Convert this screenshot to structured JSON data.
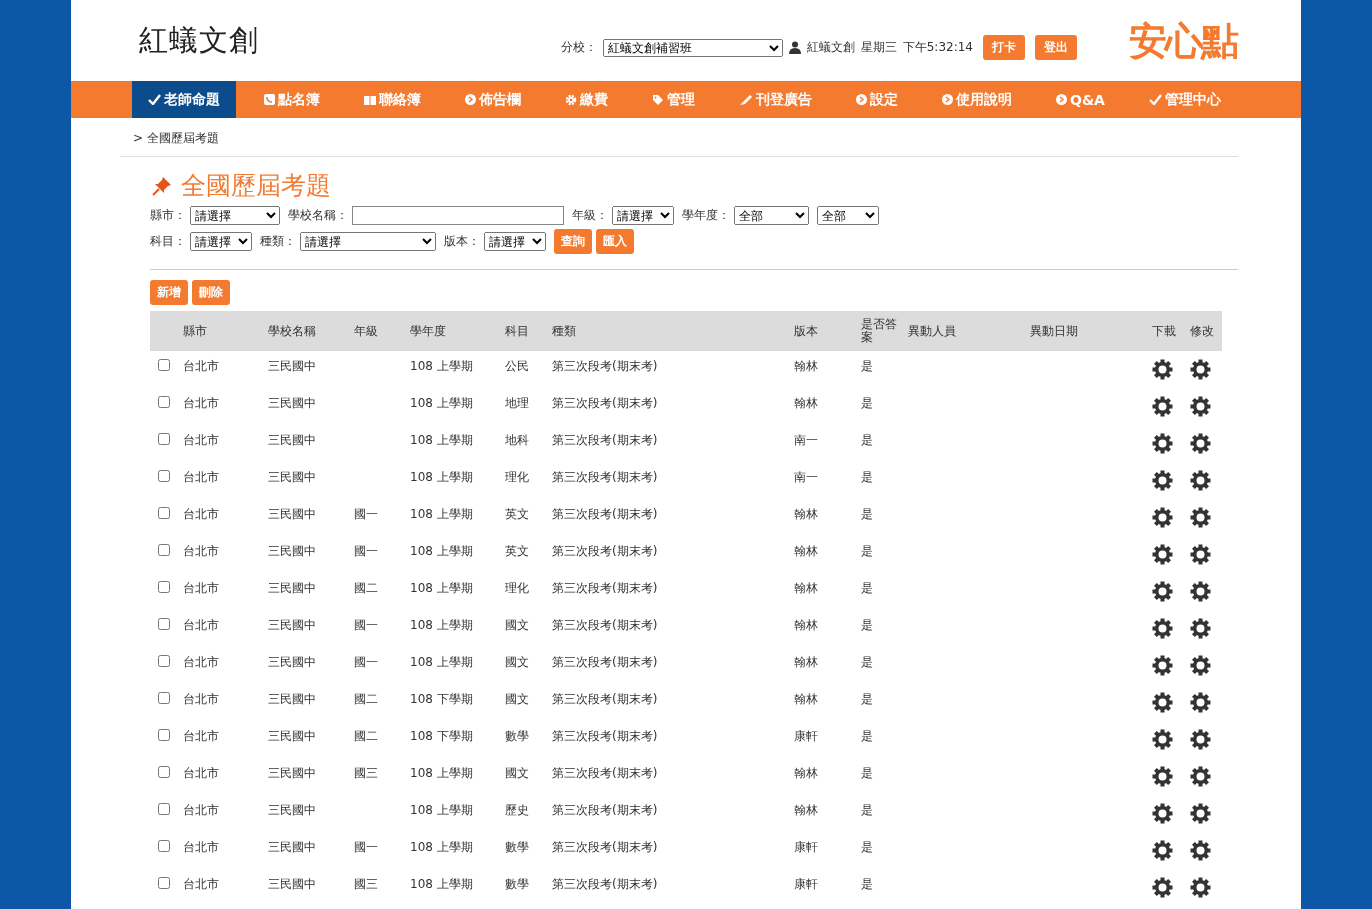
{
  "header": {
    "site_title": "紅蟻文創",
    "branch_label": "分校：",
    "branch_value": "紅蟻文創補習班",
    "user_name": "紅蟻文創",
    "weekday": "星期三",
    "time": "下午5:32:14",
    "buttons": [
      "打卡",
      "登出"
    ],
    "logo_text": "安心點"
  },
  "nav": [
    {
      "label": "老師命題",
      "selected": true
    },
    {
      "label": "點名簿",
      "selected": false
    },
    {
      "label": "聯絡簿",
      "selected": false
    },
    {
      "label": "佈告欄",
      "selected": false
    },
    {
      "label": "繳費",
      "selected": false
    },
    {
      "label": "管理",
      "selected": false
    },
    {
      "label": "刊登廣告",
      "selected": false
    },
    {
      "label": "設定",
      "selected": false
    },
    {
      "label": "使用說明",
      "selected": false
    },
    {
      "label": "Q&A",
      "selected": false
    },
    {
      "label": "管理中心",
      "selected": false
    }
  ],
  "breadcrumb": "> 全國歷屆考題",
  "page_title": "全國歷屆考題",
  "filters": {
    "row1": [
      {
        "label": "縣市：",
        "kind": "select",
        "value": "請選擇"
      },
      {
        "label": "學校名稱：",
        "kind": "input"
      },
      {
        "label": "年級：",
        "kind": "select",
        "value": "請選擇"
      },
      {
        "label": "學年度：",
        "kind": "select",
        "value": "全部"
      },
      {
        "kind": "select",
        "value": "全部"
      }
    ],
    "row2": [
      {
        "label": "科目：",
        "kind": "select",
        "value": "請選擇"
      },
      {
        "label": "種類：",
        "kind": "select",
        "value": "請選擇"
      },
      {
        "label": "版本：",
        "kind": "select",
        "value": "請選擇"
      }
    ],
    "buttons": [
      "查詢",
      "匯入"
    ]
  },
  "actions": [
    "新增",
    "刪除"
  ],
  "table": {
    "columns": [
      "縣市",
      "學校名稱",
      "年級",
      "學年度",
      "科目",
      "種類",
      "版本",
      "是否答案",
      "異動人員",
      "異動日期",
      "下載",
      "修改"
    ],
    "rows": [
      {
        "checked": false,
        "cells": [
          "台北市",
          "三民國中",
          "",
          "108 上學期",
          "公民",
          "第三次段考(期末考)",
          "翰林",
          "是",
          "",
          ""
        ]
      },
      {
        "checked": false,
        "cells": [
          "台北市",
          "三民國中",
          "",
          "108 上學期",
          "地理",
          "第三次段考(期末考)",
          "翰林",
          "是",
          "",
          ""
        ]
      },
      {
        "checked": false,
        "cells": [
          "台北市",
          "三民國中",
          "",
          "108 上學期",
          "地科",
          "第三次段考(期末考)",
          "南一",
          "是",
          "",
          ""
        ]
      },
      {
        "checked": false,
        "cells": [
          "台北市",
          "三民國中",
          "",
          "108 上學期",
          "理化",
          "第三次段考(期末考)",
          "南一",
          "是",
          "",
          ""
        ]
      },
      {
        "checked": false,
        "cells": [
          "台北市",
          "三民國中",
          "國一",
          "108 上學期",
          "英文",
          "第三次段考(期末考)",
          "翰林",
          "是",
          "",
          ""
        ]
      },
      {
        "checked": false,
        "cells": [
          "台北市",
          "三民國中",
          "國一",
          "108 上學期",
          "英文",
          "第三次段考(期末考)",
          "翰林",
          "是",
          "",
          ""
        ]
      },
      {
        "checked": false,
        "cells": [
          "台北市",
          "三民國中",
          "國二",
          "108 上學期",
          "理化",
          "第三次段考(期末考)",
          "翰林",
          "是",
          "",
          ""
        ]
      },
      {
        "checked": false,
        "cells": [
          "台北市",
          "三民國中",
          "國一",
          "108 上學期",
          "國文",
          "第三次段考(期末考)",
          "翰林",
          "是",
          "",
          ""
        ]
      },
      {
        "checked": false,
        "cells": [
          "台北市",
          "三民國中",
          "國一",
          "108 上學期",
          "國文",
          "第三次段考(期末考)",
          "翰林",
          "是",
          "",
          ""
        ]
      },
      {
        "checked": false,
        "cells": [
          "台北市",
          "三民國中",
          "國二",
          "108 下學期",
          "國文",
          "第三次段考(期末考)",
          "翰林",
          "是",
          "",
          ""
        ]
      },
      {
        "checked": false,
        "cells": [
          "台北市",
          "三民國中",
          "國二",
          "108 下學期",
          "數學",
          "第三次段考(期末考)",
          "康軒",
          "是",
          "",
          ""
        ]
      },
      {
        "checked": false,
        "cells": [
          "台北市",
          "三民國中",
          "國三",
          "108 上學期",
          "國文",
          "第三次段考(期末考)",
          "翰林",
          "是",
          "",
          ""
        ]
      },
      {
        "checked": false,
        "cells": [
          "台北市",
          "三民國中",
          "",
          "108 上學期",
          "歷史",
          "第三次段考(期末考)",
          "翰林",
          "是",
          "",
          ""
        ]
      },
      {
        "checked": false,
        "cells": [
          "台北市",
          "三民國中",
          "國一",
          "108 上學期",
          "數學",
          "第三次段考(期末考)",
          "康軒",
          "是",
          "",
          ""
        ]
      },
      {
        "checked": false,
        "cells": [
          "台北市",
          "三民國中",
          "國三",
          "108 上學期",
          "數學",
          "第三次段考(期末考)",
          "康軒",
          "是",
          "",
          ""
        ]
      }
    ]
  }
}
